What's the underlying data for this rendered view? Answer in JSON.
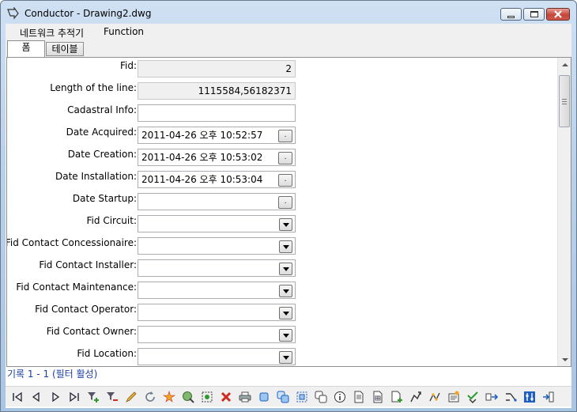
{
  "window": {
    "title": "Conductor - Drawing2.dwg"
  },
  "menu": {
    "items": [
      "네트워크 추적기",
      "Function"
    ]
  },
  "tabs": [
    {
      "label": "폼",
      "active": true
    },
    {
      "label": "테이블",
      "active": false
    }
  ],
  "form": {
    "fields": [
      {
        "label": "Fid:",
        "value": "2",
        "kind": "readonly"
      },
      {
        "label": "Length of the line:",
        "value": "1115584,56182371",
        "kind": "readonly"
      },
      {
        "label": "Cadastral Info:",
        "value": "",
        "kind": "text"
      },
      {
        "label": "Date Acquired:",
        "value": "2011-04-26 오후 10:52:57",
        "kind": "date",
        "button": "."
      },
      {
        "label": "Date Creation:",
        "value": "2011-04-26 오후 10:53:02",
        "kind": "date",
        "button": "."
      },
      {
        "label": "Date Installation:",
        "value": "2011-04-26 오후 10:53:04",
        "kind": "date",
        "button": "."
      },
      {
        "label": "Date Startup:",
        "value": "",
        "kind": "date",
        "button": "."
      },
      {
        "label": "Fid Circuit:",
        "value": "",
        "kind": "dropdown"
      },
      {
        "label": "Fid Contact Concessionaire:",
        "value": "",
        "kind": "dropdown"
      },
      {
        "label": "Fid Contact Installer:",
        "value": "",
        "kind": "dropdown"
      },
      {
        "label": "Fid Contact Maintenance:",
        "value": "",
        "kind": "dropdown"
      },
      {
        "label": "Fid Contact Operator:",
        "value": "",
        "kind": "dropdown"
      },
      {
        "label": "Fid Contact Owner:",
        "value": "",
        "kind": "dropdown"
      },
      {
        "label": "Fid Location:",
        "value": "",
        "kind": "dropdown"
      }
    ]
  },
  "status": {
    "record_text": "기록 1 - 1 (필터 활성)"
  },
  "toolbar": {
    "icons": [
      "first-record-icon",
      "previous-record-icon",
      "next-record-icon",
      "last-record-icon",
      "add-filter-icon",
      "remove-filter-icon",
      "edit-pencil-icon",
      "refresh-icon",
      "highlight-star-icon",
      "zoom-globe-icon",
      "select-zoom-icon",
      "delete-icon",
      "print-icon",
      "copy-shape-icon",
      "duplicate-icon",
      "select-box-icon",
      "clone-icon",
      "info-icon",
      "document-icon",
      "document-grid-icon",
      "document-add-icon",
      "trace-arrow-icon",
      "trace-network-icon",
      "report-icon",
      "check-down-icon",
      "export-arrow-icon",
      "flow-icon",
      "settings-sliders-icon",
      "import-arrow-icon"
    ],
    "accent_red": "#d02a1e",
    "accent_blue": "#1f5fbf",
    "accent_green": "#2e9a2e"
  }
}
